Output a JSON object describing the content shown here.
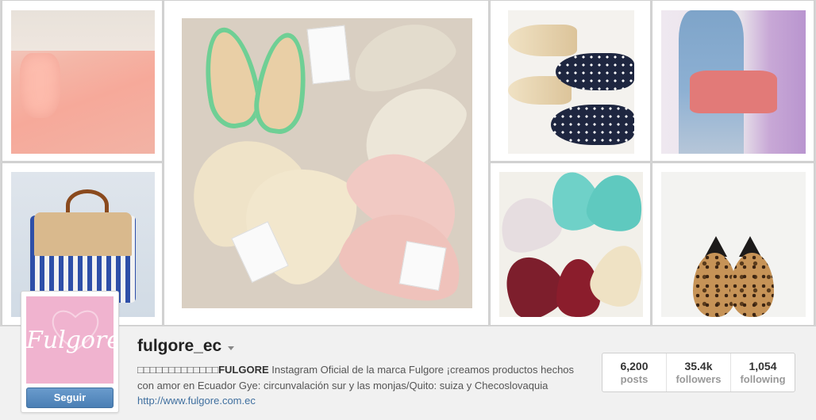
{
  "grid": {
    "photos": [
      {
        "id": "blouse",
        "alt": ""
      },
      {
        "id": "shoes-collage",
        "alt": ""
      },
      {
        "id": "polka-flats",
        "alt": ""
      },
      {
        "id": "pink-bag",
        "alt": ""
      },
      {
        "id": "striped-bag",
        "alt": ""
      },
      {
        "id": "colorful-flats",
        "alt": ""
      },
      {
        "id": "leopard-flats",
        "alt": ""
      }
    ]
  },
  "profile": {
    "avatar_logo": "Fulgore",
    "follow_label": "Seguir",
    "username": "fulgore_ec",
    "bio_prefix": "□□□□□□□□□□□□□",
    "bio_brand": "FULGORE",
    "bio_text": " Instagram Oficial de la marca Fulgore ¡creamos productos hechos con amor en Ecuador Gye: circunvalación sur y las monjas/Quito: suiza y Checoslovaquia",
    "link": "http://www.fulgore.com.ec",
    "stats": [
      {
        "value": "6,200",
        "label": "posts"
      },
      {
        "value": "35.4k",
        "label": "followers"
      },
      {
        "value": "1,054",
        "label": "following"
      }
    ]
  },
  "colors": {
    "avatar_bg": "#f0b3cf",
    "follow_button": "#4a7fb5",
    "link": "#3f6f9f"
  }
}
